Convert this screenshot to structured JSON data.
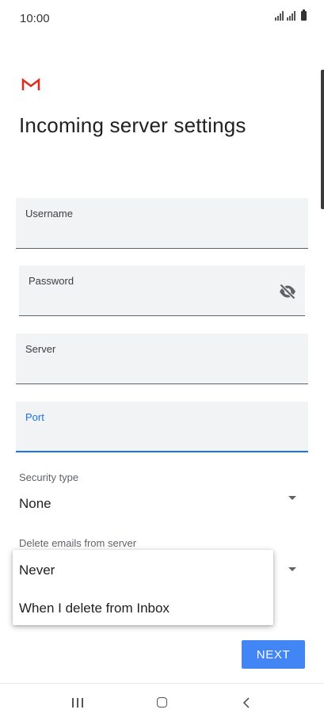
{
  "status_bar": {
    "time": "10:00"
  },
  "header": {
    "logo_icon": "gmail-logo",
    "title": "Incoming server settings"
  },
  "form": {
    "username": {
      "label": "Username",
      "value": ""
    },
    "password": {
      "label": "Password",
      "value": "",
      "toggle_icon": "visibility-off-icon"
    },
    "server": {
      "label": "Server",
      "value": ""
    },
    "port": {
      "label": "Port",
      "value": "",
      "focused": true
    },
    "security_type": {
      "label": "Security type",
      "value": "None"
    },
    "delete_emails": {
      "label": "Delete emails from server"
    }
  },
  "popup_menu": {
    "items": [
      "Never",
      "When I delete from Inbox"
    ]
  },
  "actions": {
    "next_label": "NEXT"
  },
  "nav_bar": {
    "icons": [
      "recents-icon",
      "home-icon",
      "back-icon"
    ]
  },
  "colors": {
    "accent": "#1a73e8",
    "button": "#4285f4",
    "gmail_red": "#d93025"
  }
}
